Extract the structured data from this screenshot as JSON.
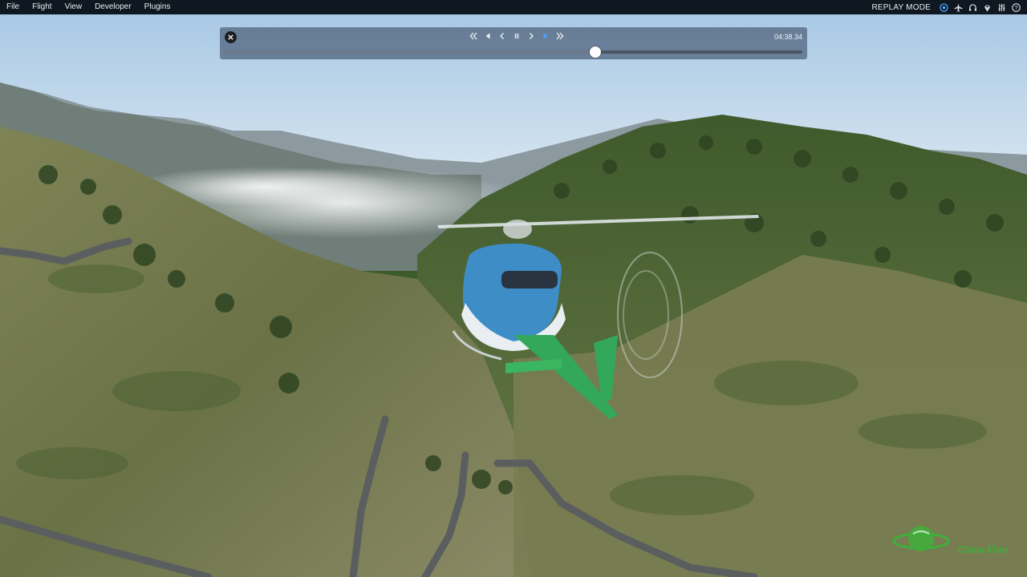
{
  "menu": {
    "items": [
      "File",
      "Flight",
      "View",
      "Developer",
      "Plugins"
    ],
    "mode_label": "REPLAY MODE",
    "icons": [
      "status-circle-icon",
      "airplane-icon",
      "headset-icon",
      "location-pin-icon",
      "sliders-icon",
      "help-icon"
    ]
  },
  "replay": {
    "time": "04:38.34",
    "progress": 0.642,
    "controls": [
      "rewind-fast-icon",
      "rewind-icon",
      "step-back-icon",
      "pause-icon",
      "step-forward-icon",
      "play-icon",
      "fast-forward-icon"
    ],
    "active_control": "play-icon"
  },
  "watermark": {
    "text": "China Flier"
  },
  "colors": {
    "menubar": "#0f1720",
    "panel": "#5f738c",
    "accent": "#4da3ff",
    "watermark": "#3fae3a"
  }
}
